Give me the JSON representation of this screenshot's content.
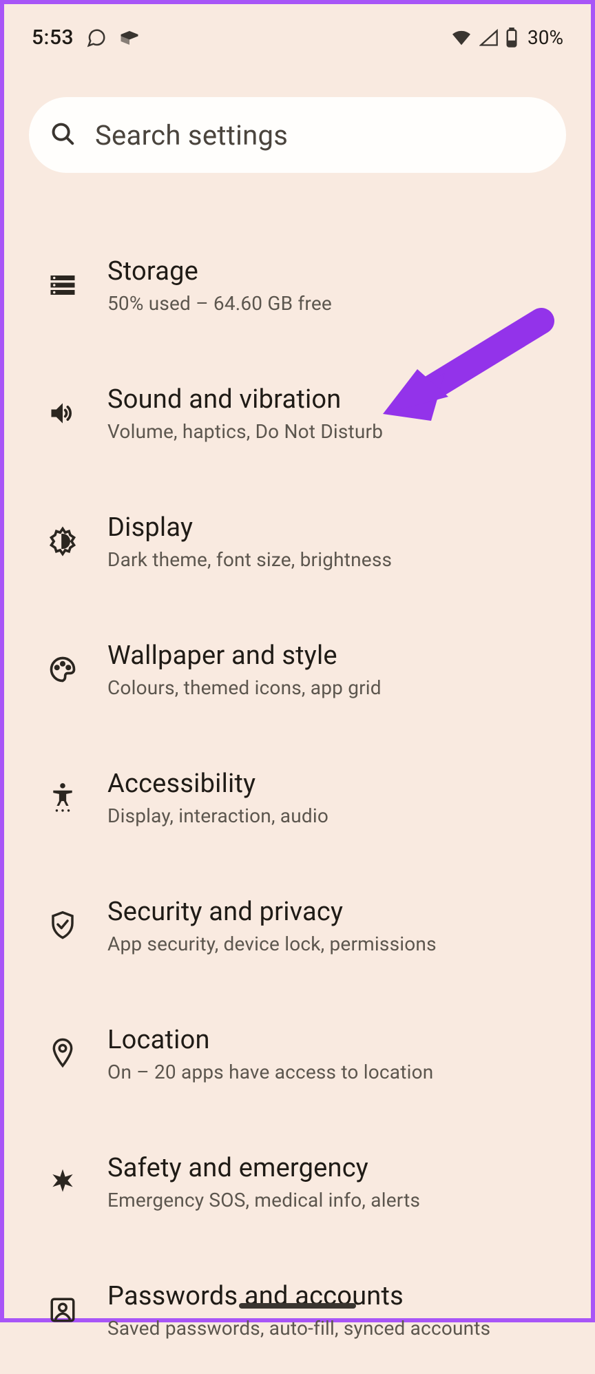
{
  "status": {
    "time": "5:53",
    "battery": "30%"
  },
  "search": {
    "placeholder": "Search settings"
  },
  "items": [
    {
      "icon": "storage",
      "title": "Storage",
      "sub": "50% used – 64.60 GB free"
    },
    {
      "icon": "sound",
      "title": "Sound and vibration",
      "sub": "Volume, haptics, Do Not Disturb"
    },
    {
      "icon": "display",
      "title": "Display",
      "sub": "Dark theme, font size, brightness"
    },
    {
      "icon": "wallpaper",
      "title": "Wallpaper and style",
      "sub": "Colours, themed icons, app grid"
    },
    {
      "icon": "accessibility",
      "title": "Accessibility",
      "sub": "Display, interaction, audio"
    },
    {
      "icon": "security",
      "title": "Security and privacy",
      "sub": "App security, device lock, permissions"
    },
    {
      "icon": "location",
      "title": "Location",
      "sub": "On – 20 apps have access to location"
    },
    {
      "icon": "safety",
      "title": "Safety and emergency",
      "sub": "Emergency SOS, medical info, alerts"
    },
    {
      "icon": "passwords",
      "title": "Passwords and accounts",
      "sub": "Saved passwords, auto-fill, synced accounts"
    }
  ],
  "annotation": {
    "arrow_color": "#9333ea"
  }
}
